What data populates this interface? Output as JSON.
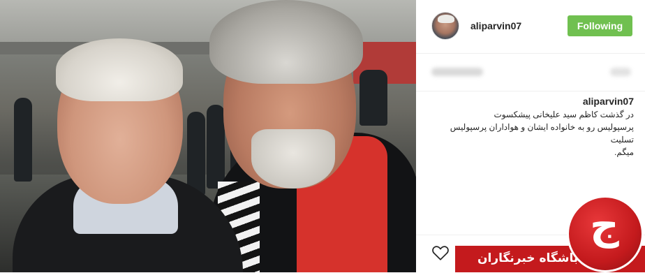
{
  "post": {
    "username": "aliparvin07",
    "follow_button_label": "Following",
    "caption_username": "aliparvin07",
    "caption_line1": "در گذشت کاظم سید علیخانی پیشکسوت",
    "caption_line2": "پرسپولیس رو به خانواده ایشان و هواداران پرسپولیس تسلیت",
    "caption_line3": "میگم."
  },
  "watermark": {
    "text": "باشگاه خبرنگاران",
    "logo_glyph": "ج"
  },
  "icons": {
    "heart": "heart-icon"
  },
  "colors": {
    "follow_button": "#70c050",
    "watermark_red": "#c41a1d"
  }
}
